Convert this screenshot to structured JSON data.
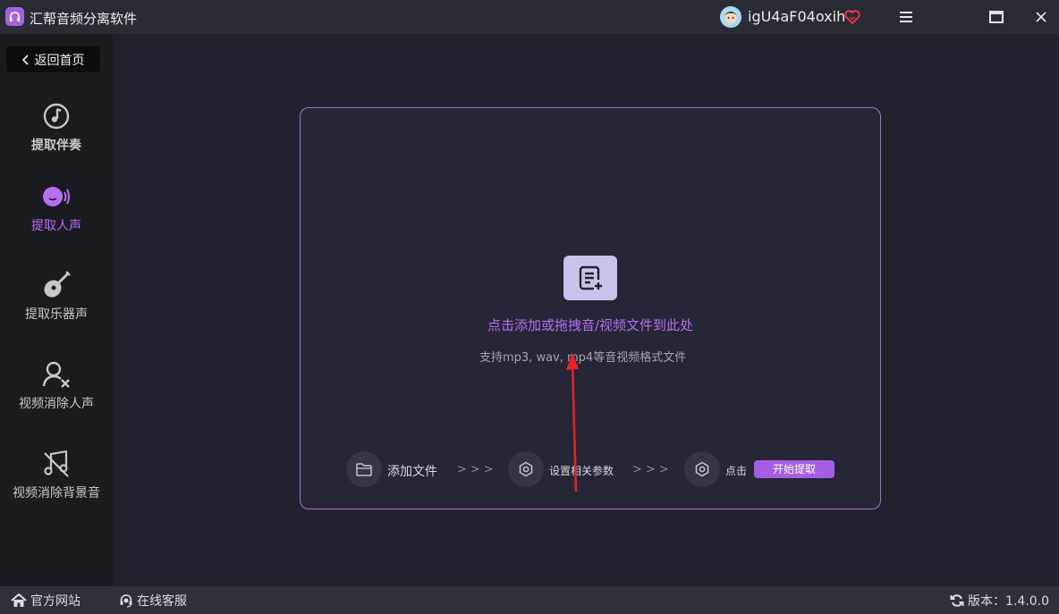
{
  "app": {
    "title": "汇帮音频分离软件",
    "logo_icon": "headphone-logo-icon",
    "accent_color": "#b36ff0"
  },
  "user": {
    "name": "igU4aF04oxih",
    "avatar_icon": "avatar-icon",
    "vip_icon": "heart-vip-icon"
  },
  "window_controls": [
    "menu-icon",
    "maximize-icon",
    "close-icon"
  ],
  "sidebar": {
    "back_label": "返回首页",
    "items": [
      {
        "label": "提取伴奏",
        "icon": "music-note-icon",
        "state": "normal"
      },
      {
        "label": "提取人声",
        "icon": "voice-icon",
        "state": "active"
      },
      {
        "label": "提取乐器声",
        "icon": "guitar-icon",
        "state": "normal"
      },
      {
        "label": "视频消除人声",
        "icon": "user-remove-icon",
        "state": "normal"
      },
      {
        "label": "视频消除背景音",
        "icon": "music-mute-icon",
        "state": "normal"
      }
    ]
  },
  "main": {
    "drop_title": "点击添加或拖拽音/视频文件到此处",
    "drop_hint": "支持mp3, wav, mp4等音视频格式文件",
    "steps": [
      {
        "label": "添加文件",
        "icon": "folder-icon"
      },
      {
        "label": "设置相关参数",
        "icon": "settings-icon"
      },
      {
        "label": "点击",
        "icon": "settings-icon"
      }
    ],
    "arrows": ">>>",
    "start_label": "开始提取"
  },
  "statusbar": {
    "website_label": "官方网站",
    "service_label": "在线客服",
    "version_label": "版本：1.4.0.0"
  }
}
